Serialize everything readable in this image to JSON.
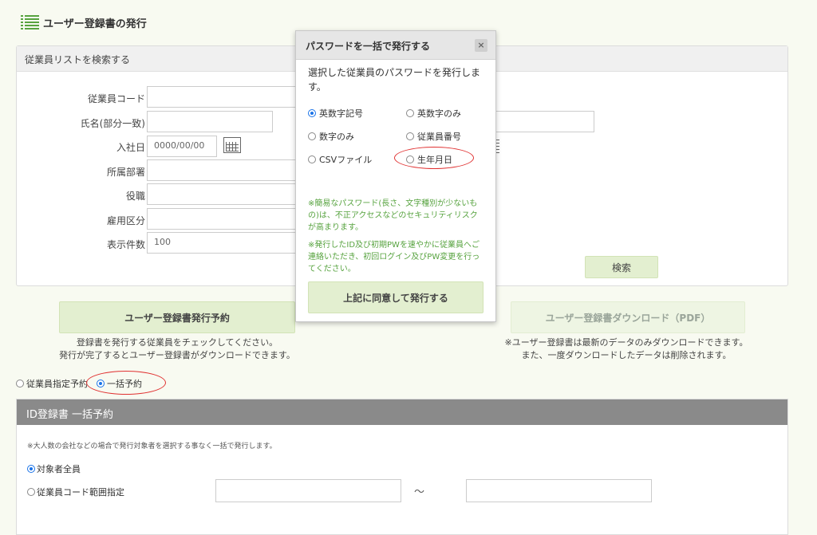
{
  "page": {
    "title": "ユーザー登録書の発行"
  },
  "search_panel": {
    "header": "従業員リストを検索する",
    "fields": {
      "employee_code_label": "従業員コード",
      "name_label": "氏名(部分一致)",
      "hire_date_label": "入社日",
      "hire_date_placeholder": "0000/00/00",
      "department_label": "所属部署",
      "position_label": "役職",
      "employment_type_label": "雇用区分",
      "display_count_label": "表示件数",
      "display_count_value": "100"
    },
    "search_button": "検索"
  },
  "actions": {
    "reserve_button": "ユーザー登録書発行予約",
    "reserve_note_1": "登録書を発行する従業員をチェックしてください。",
    "reserve_note_2": "発行が完了するとユーザー登録書がダウンロードできます。",
    "download_button": "ユーザー登録書ダウンロード（PDF）",
    "download_note_1": "※ユーザー登録書は最新のデータのみダウンロードできます。",
    "download_note_2": "また、一度ダウンロードしたデータは削除されます。"
  },
  "mode": {
    "specified_label": "従業員指定予約",
    "bulk_label": "一括予約",
    "selected": "bulk"
  },
  "bulk_section": {
    "header": "ID登録書 一括予約",
    "note": "※大人数の会社などの場合で発行対象者を選択する事なく一括で発行します。",
    "all_label": "対象者全員",
    "range_label": "従業員コード範囲指定",
    "tilde": "～"
  },
  "modal": {
    "title": "パスワードを一括で発行する",
    "description": "選択した従業員のパスワードを発行します。",
    "options": {
      "alnum_symbol": "英数字記号",
      "alnum_only": "英数字のみ",
      "numeric_only": "数字のみ",
      "employee_number": "従業員番号",
      "csv_file": "CSVファイル",
      "birthdate": "生年月日"
    },
    "selected_option": "alnum_symbol",
    "warning_1": "※簡易なパスワード(長さ、文字種別が少ないもの)は、不正アクセスなどのセキュリティリスクが高まります。",
    "warning_2": "※発行したID及び初期PWを速やかに従業員へご連絡いただき、初回ログイン及びPW変更を行ってください。",
    "agree_button": "上記に同意して発行する",
    "close_symbol": "×"
  },
  "colors": {
    "background": "#f8faf1",
    "accent_green": "#57a33f",
    "button_green": "#e3efd0",
    "radio_selected": "#1a73e8",
    "highlight_red": "#e03030",
    "section_header_gray": "#8a8a8a"
  },
  "icons": {
    "title": "list-icon",
    "calendar": "calendar-icon",
    "close": "close-icon"
  }
}
